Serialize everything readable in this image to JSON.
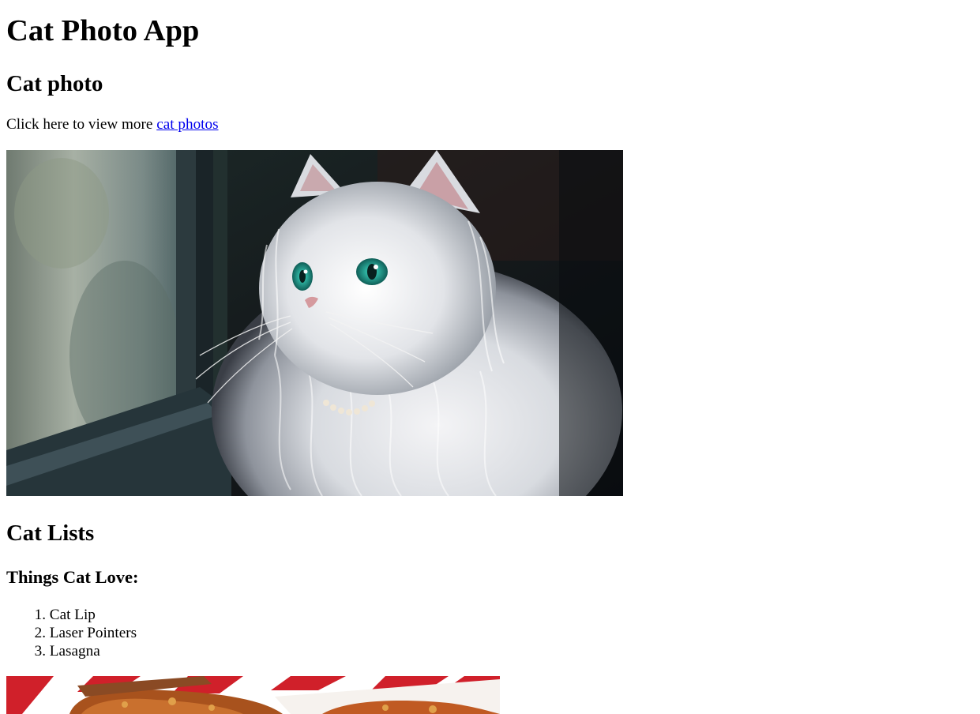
{
  "page": {
    "title": "Cat Photo App",
    "section_photo_heading": "Cat photo",
    "intro_text": "Click here to view more ",
    "intro_link": "cat photos",
    "cat_image_alt": "white fluffy cat looking out window",
    "section_lists_heading": "Cat Lists",
    "list_heading": "Things Cat Love:",
    "list_items": [
      {
        "number": "1.",
        "label": "Cat Lip"
      },
      {
        "number": "2.",
        "label": "Laser Pointers"
      },
      {
        "number": "3.",
        "label": "Lasagna"
      }
    ],
    "food_image_alt": "lasagna on a plate"
  },
  "colors": {
    "link": "#0000ee",
    "text": "#000000",
    "background": "#ffffff"
  }
}
